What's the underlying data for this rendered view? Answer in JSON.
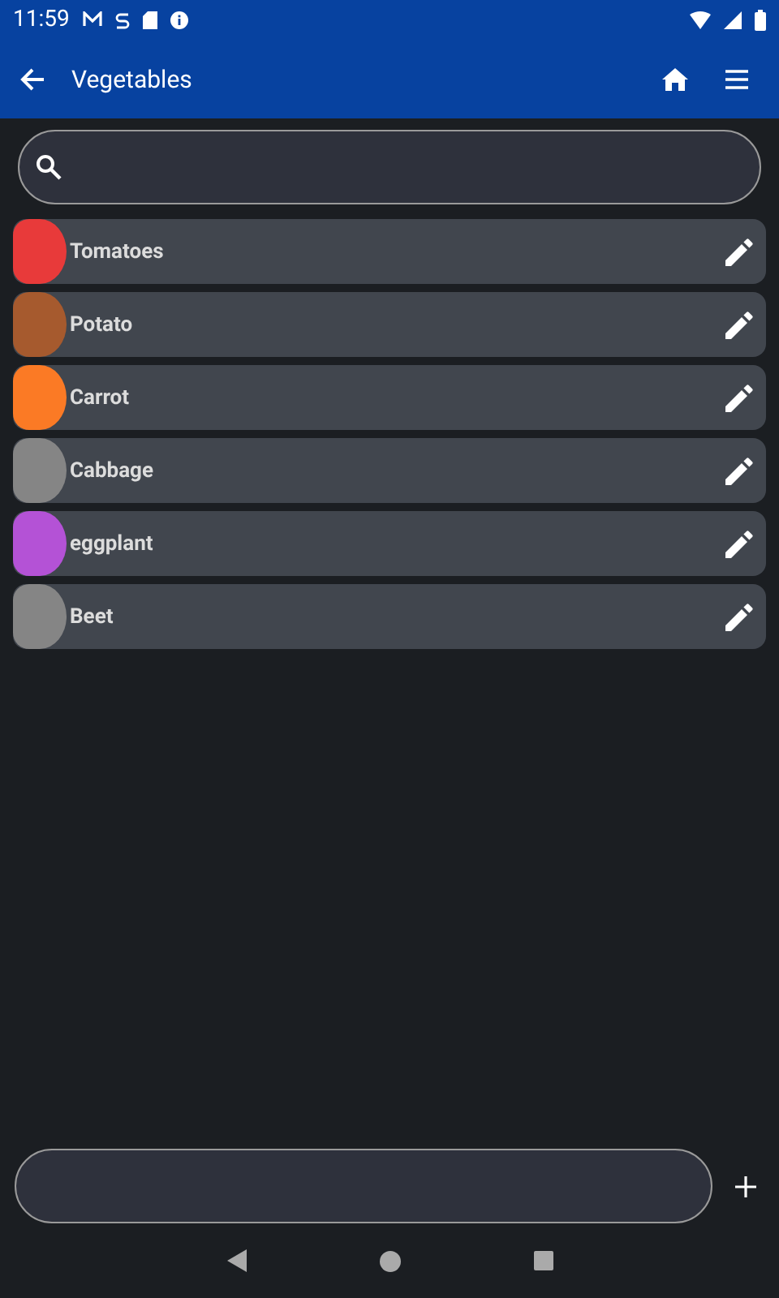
{
  "status_bar": {
    "time": "11:59"
  },
  "app_bar": {
    "title": "Vegetables"
  },
  "items": [
    {
      "name": "Tomatoes",
      "color": "#e83a3a"
    },
    {
      "name": "Potato",
      "color": "#a65a2e"
    },
    {
      "name": "Carrot",
      "color": "#fb7a25"
    },
    {
      "name": "Cabbage",
      "color": "#858585"
    },
    {
      "name": "eggplant",
      "color": "#b452d6"
    },
    {
      "name": "Beet",
      "color": "#858585"
    }
  ]
}
